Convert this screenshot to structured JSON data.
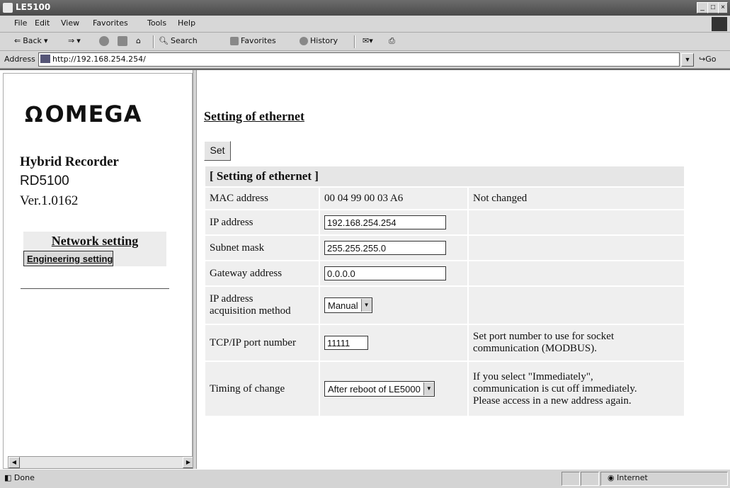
{
  "window": {
    "title": "LE5100"
  },
  "menu": [
    "File",
    "Edit",
    "View",
    "Favorites",
    "Tools",
    "Help"
  ],
  "toolbar": {
    "back": "Back",
    "search": "Search",
    "favorites": "Favorites",
    "history": "History"
  },
  "address": {
    "label": "Address",
    "url": "http://192.168.254.254/",
    "go": "Go"
  },
  "left": {
    "logo": "OMEGA",
    "product_line1": "Hybrid Recorder",
    "product_line2": "RD5100",
    "version": "Ver.1.0162",
    "nav": [
      "Network setting",
      "Engineering setting"
    ]
  },
  "main": {
    "title": "Setting of ethernet",
    "set_button": "Set",
    "section_header": "[ Setting of ethernet ]",
    "rows": {
      "mac": {
        "label": "MAC address",
        "value": "00 04 99 00 03 A6",
        "note": "Not changed"
      },
      "ip": {
        "label": "IP address",
        "value": "192.168.254.254"
      },
      "subnet": {
        "label": "Subnet mask",
        "value": "255.255.255.0"
      },
      "gateway": {
        "label": "Gateway address",
        "value": "0.0.0.0"
      },
      "acq": {
        "label_line1": "IP address",
        "label_line2": "acquisition method",
        "value": "Manual"
      },
      "port": {
        "label": "TCP/IP port number",
        "value": "11111",
        "note_line1": "Set port number to use for socket",
        "note_line2": "communication (MODBUS)."
      },
      "timing": {
        "label": "Timing of change",
        "value": "After reboot of LE5000",
        "note_line1": "If you select \"Immediately\",",
        "note_line2": "communication is cut off immediately.",
        "note_line3": "Please access in a new address again."
      }
    }
  },
  "status": {
    "left": "Done",
    "zone": "Internet"
  }
}
